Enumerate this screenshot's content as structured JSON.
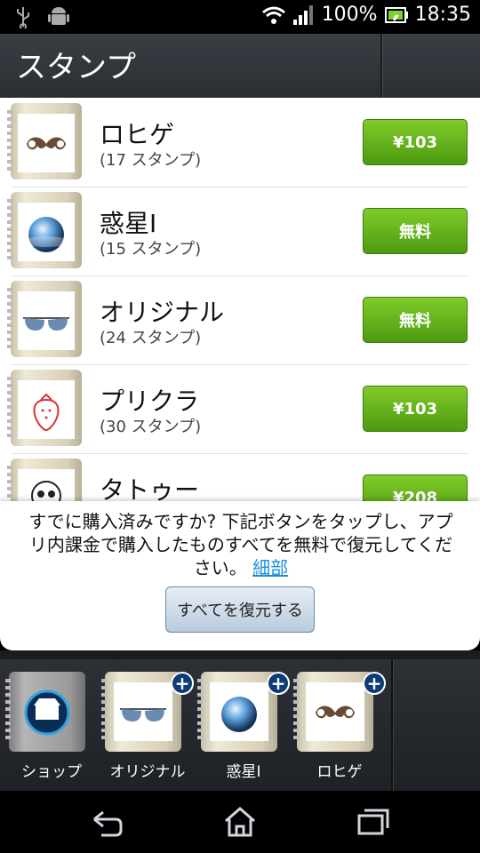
{
  "status": {
    "battery": "100%",
    "time": "18:35"
  },
  "header": {
    "title": "スタンプ"
  },
  "stamps": [
    {
      "name": "ロヒゲ",
      "count": "(17 スタンプ)",
      "price": "¥103",
      "icon": "mustache-icon"
    },
    {
      "name": "惑星I",
      "count": "(15 スタンプ)",
      "price": "無料",
      "icon": "planet-icon"
    },
    {
      "name": "オリジナル",
      "count": "(24 スタンプ)",
      "price": "無料",
      "icon": "sunglasses-icon"
    },
    {
      "name": "プリクラ",
      "count": "(30 スタンプ)",
      "price": "¥103",
      "icon": "strawberry-icon"
    },
    {
      "name": "タトゥー",
      "count": "",
      "price": "¥208",
      "icon": "skull-icon"
    }
  ],
  "dialog": {
    "message": "すでに購入済みですか? 下記ボタンをタップし、アプリ内課金で購入したものすべてを無料で復元してください。",
    "link": "細部",
    "restore_label": "すべてを復元する"
  },
  "shelf": [
    {
      "label": "ショップ",
      "icon": "shop-icon"
    },
    {
      "label": "オリジナル",
      "icon": "sunglasses-icon"
    },
    {
      "label": "惑星I",
      "icon": "planet-icon"
    },
    {
      "label": "ロヒゲ",
      "icon": "mustache-icon"
    }
  ]
}
